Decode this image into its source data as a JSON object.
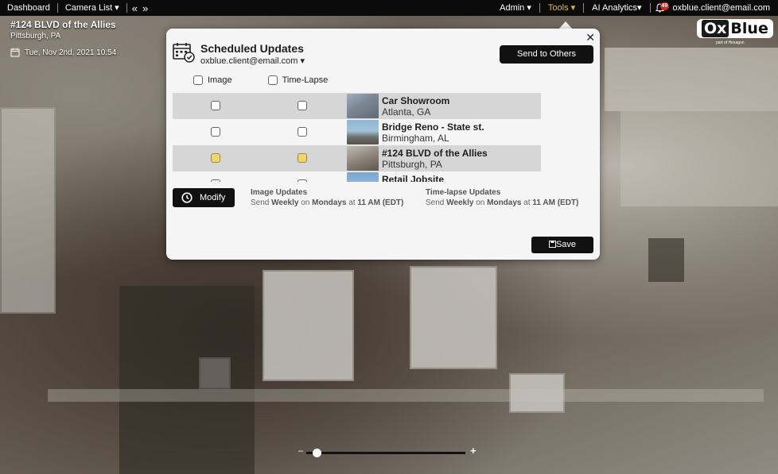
{
  "topbar": {
    "dashboard": "Dashboard",
    "camera_list": "Camera List ▾",
    "prev": "«",
    "next": "»",
    "admin": "Admin ▾",
    "tools": "Tools ▾",
    "ai_analytics": "AI Analytics▾",
    "notification_count": "49",
    "user_email": "oxblue.client@email.com",
    "tools_color": "#e8b84a"
  },
  "site": {
    "title": "#124 BLVD of the Allies",
    "location": "Pittsburgh, PA",
    "date": "Tue, Nov 2nd, 2021 10:54"
  },
  "logo": {
    "ox": "Ox",
    "blue": "Blue",
    "sub": "part of Hexagon"
  },
  "modal": {
    "close": "✕",
    "title": "Scheduled Updates",
    "email": "oxblue.client@email.com ▾",
    "send_button": "Send to Others",
    "col_image": "Image",
    "col_timelapse": "Time-Lapse",
    "projects": [
      {
        "name": "Car Showroom",
        "location": "Atlanta, GA",
        "image_checked": false,
        "timelapse_checked": false
      },
      {
        "name": "Bridge Reno - State st.",
        "location": "Birmingham, AL",
        "image_checked": false,
        "timelapse_checked": false
      },
      {
        "name": "#124 BLVD of the Allies",
        "location": "Pittsburgh, PA",
        "image_checked": true,
        "timelapse_checked": true
      },
      {
        "name": "Retail Jobsite",
        "location": "",
        "image_checked": false,
        "timelapse_checked": false
      }
    ],
    "modify_button": "Modify",
    "image_updates": {
      "title": "Image Updates",
      "send": "Send",
      "frequency": "Weekly",
      "on": "on",
      "day": "Mondays",
      "at": "at",
      "time": "11 AM",
      "tz": "(EDT)"
    },
    "timelapse_updates": {
      "title": "Time-lapse Updates",
      "send": "Send",
      "frequency": "Weekly",
      "on": "on",
      "day": "Mondays",
      "at": "at",
      "time": "11 AM",
      "tz": "(EDT)"
    },
    "save_button": "Save"
  }
}
